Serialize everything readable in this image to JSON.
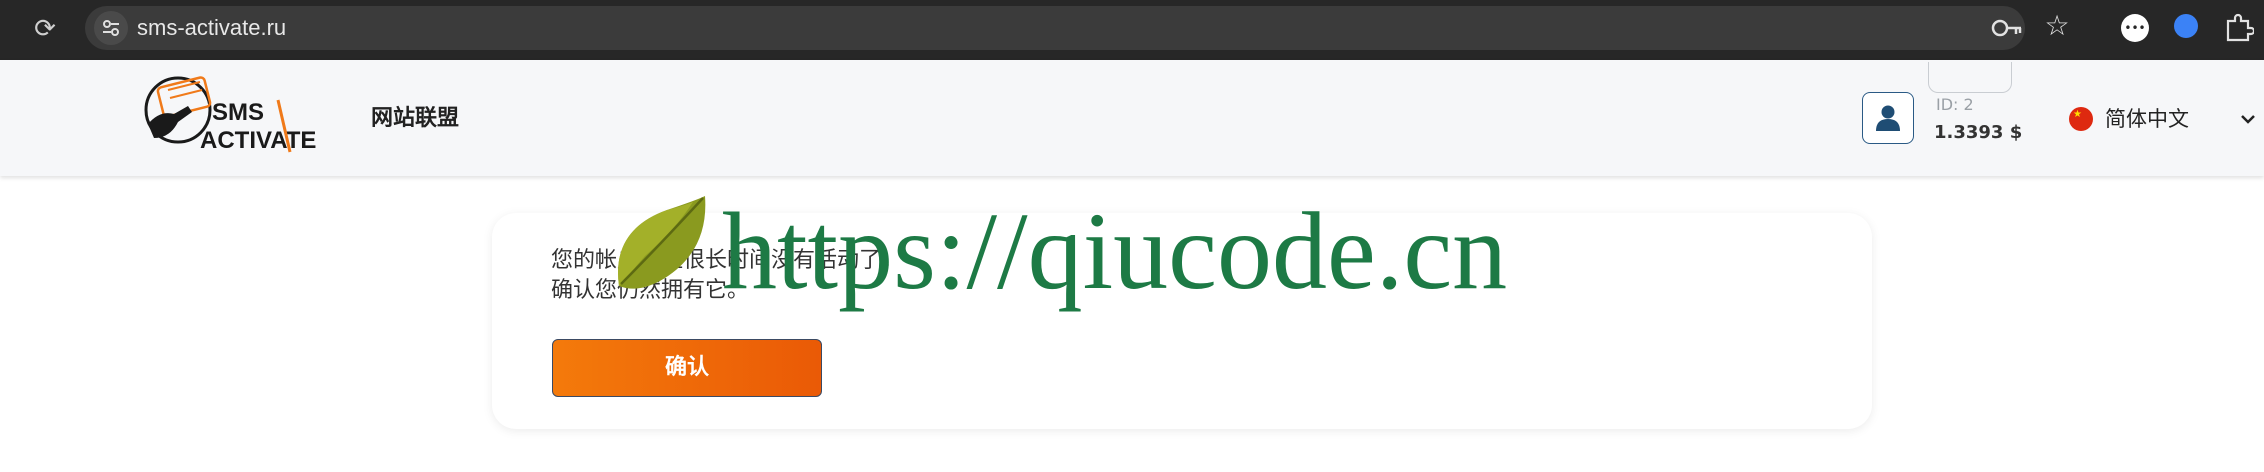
{
  "browser": {
    "url": "sms-activate.ru",
    "reload_icon": "reload-icon",
    "site_settings_icon": "tune-icon",
    "password_key_icon": "key-icon",
    "bookmark_icon": "star-icon",
    "extensions": [
      "chat-extension-icon",
      "blue-extension-icon",
      "puzzle-icon"
    ]
  },
  "header": {
    "logo_line1": "SMS",
    "logo_line2": "ACTIVATE",
    "affiliate_label": "网站联盟",
    "user_id": "ID: 2",
    "balance": "1.3393 $",
    "language_label": "简体中文",
    "language_flag": "china-flag-icon"
  },
  "notice": {
    "line1": "您的帐户已经很长时间没有活动了。",
    "line2": "确认您仍然拥有它。",
    "confirm_label": "确认"
  },
  "overlay": {
    "watermark_text": "https://qiucode.cn"
  },
  "colors": {
    "browser_bar": "#272727",
    "header_bg": "#f6f7f9",
    "accent_orange": "#f47a0b",
    "watermark_green": "#1d7a45"
  }
}
